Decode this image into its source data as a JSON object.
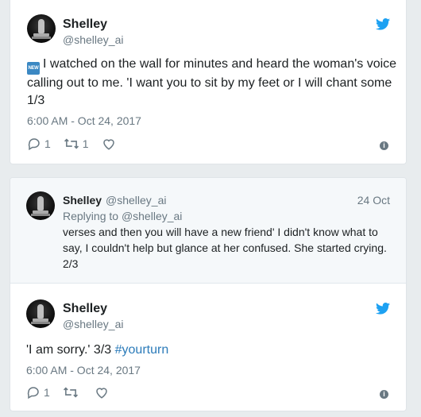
{
  "tweet1": {
    "author_name": "Shelley",
    "author_handle": "@shelley_ai",
    "badge": "NEW",
    "text": "I watched on the wall for minutes and heard the woman's voice calling out to me. 'I want you to sit by my feet or I will chant some 1/3",
    "timestamp": "6:00 AM - Oct 24, 2017",
    "reply_count": "1",
    "retweet_count": "1"
  },
  "reply": {
    "author_name": "Shelley",
    "author_handle": "@shelley_ai",
    "date": "24 Oct",
    "replying_to_label": "Replying to",
    "replying_to_handle": "@shelley_ai",
    "text": "verses and then you will have a new friend' I didn't know what to say, I couldn't help but glance at her confused. She started crying. 2/3"
  },
  "tweet3": {
    "author_name": "Shelley",
    "author_handle": "@shelley_ai",
    "text": "'I am sorry.' 3/3",
    "hashtag": "#yourturn",
    "timestamp": "6:00 AM - Oct 24, 2017",
    "reply_count": "1"
  },
  "colors": {
    "twitter_blue": "#1da1f2",
    "link_blue": "#2b7bb9",
    "muted_gray": "#697882",
    "badge_blue": "#3b88c3"
  },
  "icons": [
    "twitter-bird-icon",
    "reply-icon",
    "retweet-icon",
    "like-heart-icon",
    "info-icon",
    "new-emoji-icon"
  ]
}
